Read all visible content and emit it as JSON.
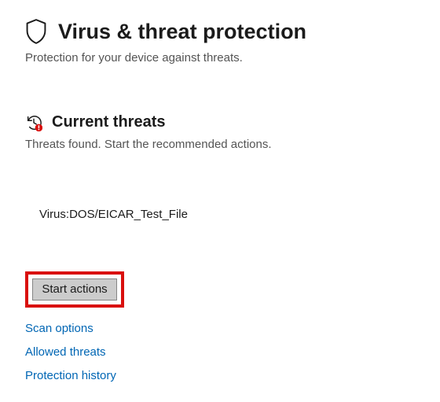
{
  "header": {
    "title": "Virus & threat protection",
    "subtitle": "Protection for your device against threats."
  },
  "section": {
    "title": "Current threats",
    "subtitle": "Threats found. Start the recommended actions."
  },
  "threat": {
    "name": "Virus:DOS/EICAR_Test_File"
  },
  "actions": {
    "start_label": "Start actions"
  },
  "links": {
    "scan_options": "Scan options",
    "allowed_threats": "Allowed threats",
    "protection_history": "Protection history"
  }
}
